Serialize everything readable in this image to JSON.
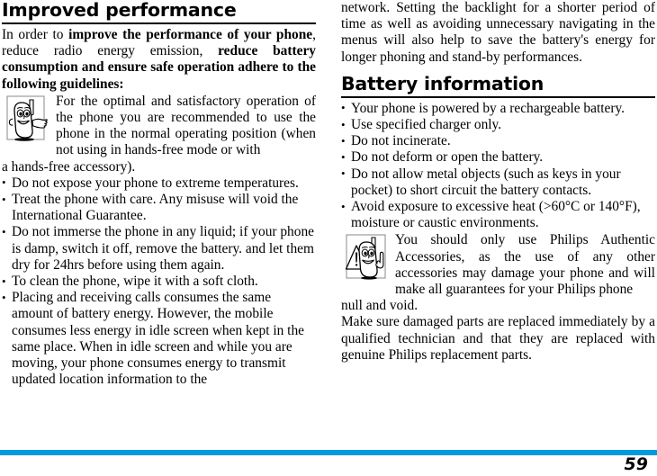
{
  "document": {
    "page_number": "59",
    "accent_color": "#0099DE"
  },
  "left_column": {
    "heading": "Improved performance",
    "intro": {
      "part1": "In order to ",
      "bold1": "improve the performance of your phone",
      "part2": ", reduce radio energy emission, ",
      "bold2": "reduce battery consumption and ensure safe operation adhere to the following guidelines:"
    },
    "note": {
      "icon_name": "phone-character-thumbs-up-icon",
      "text": "For the optimal and satisfactory operation of the phone you are recommended to use the phone in the normal operating position (when not using in hands-free mode or with",
      "tail": "a hands-free accessory)."
    },
    "bullets": [
      "Do not expose your phone to extreme temperatures.",
      "Treat the phone with care. Any misuse will void the International Guarantee.",
      "Do not immerse the phone in any liquid; if your phone is damp, switch it off, remove the battery. and let them dry for 24hrs before using them again.",
      "To clean the phone, wipe it with a soft cloth.",
      "Placing and receiving calls consumes the same amount of battery energy. However, the mobile consumes less energy in idle screen when kept in the same place. When in idle screen and while you are moving, your phone consumes energy to transmit updated location information to the"
    ]
  },
  "right_column": {
    "continuation": "network. Setting the backlight for a shorter period of time as well as avoiding unnecessary navigating in the menus will also help to save the battery's energy for longer phoning and stand-by performances.",
    "heading": "Battery information",
    "bullets": [
      "Your phone is powered by a rechargeable battery.",
      "Use specified charger only.",
      "Do not incinerate.",
      "Do not deform or open the battery.",
      "Do not allow metal objects (such as keys in your pocket) to short circuit the battery contacts.",
      "Avoid exposure to excessive heat (>60°C or 140°F), moisture or caustic environments."
    ],
    "note": {
      "icon_name": "phone-character-warning-triangle-icon",
      "text": "You should only use Philips Authentic Accessories, as the use of any other accessories may damage your phone and will make all guarantees for your Philips phone",
      "tail": "null and void."
    },
    "closing": "Make sure damaged parts are replaced immediately by a qualified technician and that they are replaced with genuine Philips replacement parts."
  }
}
